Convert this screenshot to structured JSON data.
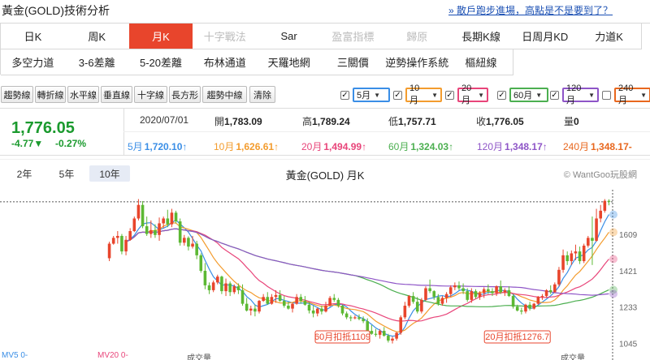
{
  "header": {
    "title": "黃金(GOLD)技術分析",
    "promo": "» 散戶跑步進場，高點是不是要到了？"
  },
  "tabs": {
    "row1": [
      {
        "label": "日K",
        "state": "normal"
      },
      {
        "label": "周K",
        "state": "normal"
      },
      {
        "label": "月K",
        "state": "active"
      },
      {
        "label": "十字戰法",
        "state": "disabled"
      },
      {
        "label": "Sar",
        "state": "normal"
      },
      {
        "label": "盈富指標",
        "state": "disabled"
      },
      {
        "label": "歸原",
        "state": "disabled"
      },
      {
        "label": "長期K線",
        "state": "normal"
      },
      {
        "label": "日周月KD",
        "state": "normal"
      },
      {
        "label": "力道K",
        "state": "normal"
      }
    ],
    "row2": [
      {
        "label": "多空力道",
        "state": "normal"
      },
      {
        "label": "3-6差離",
        "state": "normal"
      },
      {
        "label": "5-20差離",
        "state": "normal"
      },
      {
        "label": "布林通道",
        "state": "normal"
      },
      {
        "label": "天羅地網",
        "state": "normal"
      },
      {
        "label": "三關價",
        "state": "normal"
      },
      {
        "label": "逆勢操作系統",
        "state": "normal"
      },
      {
        "label": "樞紐線",
        "state": "normal"
      }
    ]
  },
  "toolbar": {
    "tools": [
      "趨勢線",
      "轉折線",
      "水平線",
      "垂直線",
      "十字線",
      "長方形",
      "趨勢中線",
      "清除"
    ],
    "ma_selectors": [
      {
        "label": "5月",
        "checked": true,
        "color": "#3a8ee6"
      },
      {
        "label": "10月",
        "checked": true,
        "color": "#f39c2e"
      },
      {
        "label": "20月",
        "checked": true,
        "color": "#e8457a"
      },
      {
        "label": "60月",
        "checked": true,
        "color": "#4caf50"
      },
      {
        "label": "120月",
        "checked": true,
        "color": "#8e55c7"
      },
      {
        "label": "240月",
        "checked": false,
        "color": "#e8671e"
      }
    ]
  },
  "quote": {
    "price": "1,776.05",
    "change": "-4.77▼",
    "change_pct": "-0.27%",
    "date": "2020/07/01",
    "open_label": "開",
    "open": "1,783.09",
    "high_label": "高",
    "high": "1,789.24",
    "low_label": "低",
    "low": "1,757.71",
    "close_label": "收",
    "close": "1,776.05",
    "vol_label": "量",
    "vol": "0",
    "ma": [
      {
        "label": "5月",
        "value": "1,720.10↑",
        "color": "#3a8ee6"
      },
      {
        "label": "10月",
        "value": "1,626.61↑",
        "color": "#f39c2e"
      },
      {
        "label": "20月",
        "value": "1,494.99↑",
        "color": "#e8457a"
      },
      {
        "label": "60月",
        "value": "1,324.03↑",
        "color": "#4caf50"
      },
      {
        "label": "120月",
        "value": "1,348.17↑",
        "color": "#8e55c7"
      },
      {
        "label": "240月",
        "value": "1,348.17-",
        "color": "#e8671e"
      }
    ]
  },
  "chart_controls": {
    "periods": [
      "2年",
      "5年",
      "10年"
    ],
    "active_period": "10年",
    "title": "黃金(GOLD) 月K",
    "copyright": "© WantGoo玩股網"
  },
  "footer": {
    "mv5": "MV5 0-",
    "mv20": "MV20 0-",
    "vol_left": "成交量",
    "vol_right": "成交量"
  },
  "chart_data": {
    "type": "candlestick",
    "title": "黃金(GOLD) 月K",
    "y_ticks": [
      1045,
      1233,
      1421,
      1609
    ],
    "ylim": [
      1010,
      1830
    ],
    "up_color": "#e8452c",
    "down_color": "#5cb833",
    "candles": [
      [
        1485,
        1570,
        1470,
        1560
      ],
      [
        1560,
        1600,
        1555,
        1590
      ],
      [
        1590,
        1625,
        1560,
        1600
      ],
      [
        1600,
        1610,
        1505,
        1520
      ],
      [
        1520,
        1600,
        1500,
        1580
      ],
      [
        1580,
        1640,
        1575,
        1625
      ],
      [
        1625,
        1700,
        1620,
        1690
      ],
      [
        1690,
        1790,
        1680,
        1760
      ],
      [
        1760,
        1780,
        1640,
        1650
      ],
      [
        1650,
        1700,
        1600,
        1610
      ],
      [
        1610,
        1680,
        1590,
        1630
      ],
      [
        1630,
        1660,
        1590,
        1605
      ],
      [
        1605,
        1695,
        1575,
        1665
      ],
      [
        1665,
        1700,
        1640,
        1690
      ],
      [
        1690,
        1735,
        1645,
        1660
      ],
      [
        1660,
        1740,
        1645,
        1720
      ],
      [
        1720,
        1730,
        1665,
        1675
      ],
      [
        1675,
        1690,
        1550,
        1565
      ],
      [
        1565,
        1605,
        1550,
        1590
      ],
      [
        1590,
        1598,
        1525,
        1545
      ],
      [
        1545,
        1600,
        1535,
        1560
      ],
      [
        1560,
        1575,
        1480,
        1500
      ],
      [
        1500,
        1510,
        1410,
        1420
      ],
      [
        1420,
        1460,
        1325,
        1345
      ],
      [
        1345,
        1360,
        1300,
        1320
      ],
      [
        1320,
        1370,
        1310,
        1360
      ],
      [
        1360,
        1400,
        1350,
        1390
      ],
      [
        1390,
        1395,
        1300,
        1315
      ],
      [
        1315,
        1380,
        1290,
        1355
      ],
      [
        1355,
        1365,
        1290,
        1310
      ],
      [
        1310,
        1350,
        1300,
        1340
      ],
      [
        1340,
        1355,
        1300,
        1320
      ],
      [
        1320,
        1350,
        1240,
        1250
      ],
      [
        1250,
        1280,
        1210,
        1215
      ],
      [
        1215,
        1240,
        1190,
        1225
      ],
      [
        1225,
        1245,
        1185,
        1210
      ],
      [
        1210,
        1270,
        1200,
        1265
      ],
      [
        1265,
        1300,
        1260,
        1285
      ],
      [
        1285,
        1310,
        1245,
        1250
      ],
      [
        1250,
        1300,
        1245,
        1285
      ],
      [
        1285,
        1320,
        1255,
        1295
      ],
      [
        1295,
        1320,
        1260,
        1265
      ],
      [
        1265,
        1290,
        1230,
        1240
      ],
      [
        1240,
        1260,
        1220,
        1225
      ],
      [
        1225,
        1255,
        1205,
        1250
      ],
      [
        1250,
        1300,
        1245,
        1285
      ],
      [
        1285,
        1300,
        1250,
        1265
      ],
      [
        1265,
        1290,
        1240,
        1245
      ],
      [
        1245,
        1260,
        1200,
        1215
      ],
      [
        1215,
        1240,
        1180,
        1200
      ],
      [
        1200,
        1230,
        1185,
        1225
      ],
      [
        1225,
        1240,
        1195,
        1210
      ],
      [
        1210,
        1260,
        1205,
        1240
      ],
      [
        1240,
        1290,
        1235,
        1280
      ],
      [
        1280,
        1300,
        1260,
        1270
      ],
      [
        1270,
        1280,
        1230,
        1240
      ],
      [
        1240,
        1245,
        1190,
        1200
      ],
      [
        1200,
        1210,
        1170,
        1180
      ],
      [
        1180,
        1190,
        1160,
        1175
      ],
      [
        1175,
        1190,
        1170,
        1180
      ],
      [
        1180,
        1195,
        1165,
        1172
      ],
      [
        1172,
        1185,
        1150,
        1160
      ],
      [
        1160,
        1175,
        1100,
        1110
      ],
      [
        1110,
        1140,
        1090,
        1095
      ],
      [
        1095,
        1120,
        1080,
        1090
      ],
      [
        1090,
        1120,
        1070,
        1110
      ],
      [
        1110,
        1130,
        1080,
        1085
      ],
      [
        1085,
        1095,
        1050,
        1060
      ],
      [
        1060,
        1080,
        1045,
        1070
      ],
      [
        1070,
        1105,
        1060,
        1100
      ],
      [
        1100,
        1190,
        1090,
        1180
      ],
      [
        1180,
        1260,
        1170,
        1240
      ],
      [
        1240,
        1295,
        1230,
        1290
      ],
      [
        1290,
        1310,
        1250,
        1260
      ],
      [
        1260,
        1285,
        1200,
        1210
      ],
      [
        1210,
        1280,
        1200,
        1270
      ],
      [
        1270,
        1340,
        1265,
        1330
      ],
      [
        1330,
        1375,
        1305,
        1315
      ],
      [
        1315,
        1320,
        1270,
        1285
      ],
      [
        1285,
        1300,
        1240,
        1250
      ],
      [
        1250,
        1290,
        1240,
        1280
      ],
      [
        1280,
        1310,
        1255,
        1300
      ],
      [
        1300,
        1345,
        1285,
        1335
      ],
      [
        1335,
        1360,
        1320,
        1345
      ],
      [
        1345,
        1365,
        1320,
        1330
      ],
      [
        1330,
        1355,
        1300,
        1315
      ],
      [
        1315,
        1330,
        1260,
        1270
      ],
      [
        1270,
        1330,
        1255,
        1315
      ],
      [
        1315,
        1325,
        1275,
        1285
      ],
      [
        1285,
        1315,
        1270,
        1305
      ],
      [
        1305,
        1335,
        1280,
        1325
      ],
      [
        1325,
        1350,
        1300,
        1315
      ],
      [
        1315,
        1330,
        1290,
        1305
      ],
      [
        1305,
        1345,
        1290,
        1340
      ],
      [
        1340,
        1370,
        1300,
        1310
      ],
      [
        1310,
        1330,
        1290,
        1320
      ],
      [
        1320,
        1340,
        1285,
        1290
      ],
      [
        1290,
        1300,
        1225,
        1235
      ],
      [
        1235,
        1245,
        1210,
        1215
      ],
      [
        1215,
        1230,
        1195,
        1210
      ],
      [
        1210,
        1250,
        1200,
        1245
      ],
      [
        1245,
        1260,
        1215,
        1225
      ],
      [
        1225,
        1255,
        1220,
        1250
      ],
      [
        1250,
        1290,
        1245,
        1285
      ],
      [
        1285,
        1300,
        1270,
        1290
      ],
      [
        1290,
        1325,
        1280,
        1320
      ],
      [
        1320,
        1345,
        1300,
        1310
      ],
      [
        1310,
        1360,
        1305,
        1350
      ],
      [
        1350,
        1440,
        1340,
        1425
      ],
      [
        1425,
        1530,
        1410,
        1500
      ],
      [
        1500,
        1520,
        1450,
        1470
      ],
      [
        1470,
        1525,
        1450,
        1510
      ],
      [
        1510,
        1555,
        1475,
        1520
      ],
      [
        1520,
        1545,
        1455,
        1470
      ],
      [
        1470,
        1560,
        1460,
        1550
      ],
      [
        1550,
        1600,
        1540,
        1590
      ],
      [
        1590,
        1700,
        1450,
        1575
      ],
      [
        1575,
        1740,
        1570,
        1690
      ],
      [
        1690,
        1760,
        1670,
        1730
      ],
      [
        1730,
        1790,
        1720,
        1781
      ],
      [
        1781,
        1789,
        1758,
        1776
      ]
    ],
    "ma_overlays": [
      {
        "name": "5月",
        "color": "#3a8ee6"
      },
      {
        "name": "10月",
        "color": "#f39c2e"
      },
      {
        "name": "20月",
        "color": "#e8457a"
      },
      {
        "name": "60月",
        "color": "#4caf50"
      },
      {
        "name": "120月",
        "color": "#8e55c7"
      }
    ],
    "annotations": [
      {
        "text": "60月扣抵1109",
        "index": 56
      },
      {
        "text": "20月扣抵1276.7",
        "index": 98
      }
    ],
    "grid": false,
    "last_price_line": true
  }
}
